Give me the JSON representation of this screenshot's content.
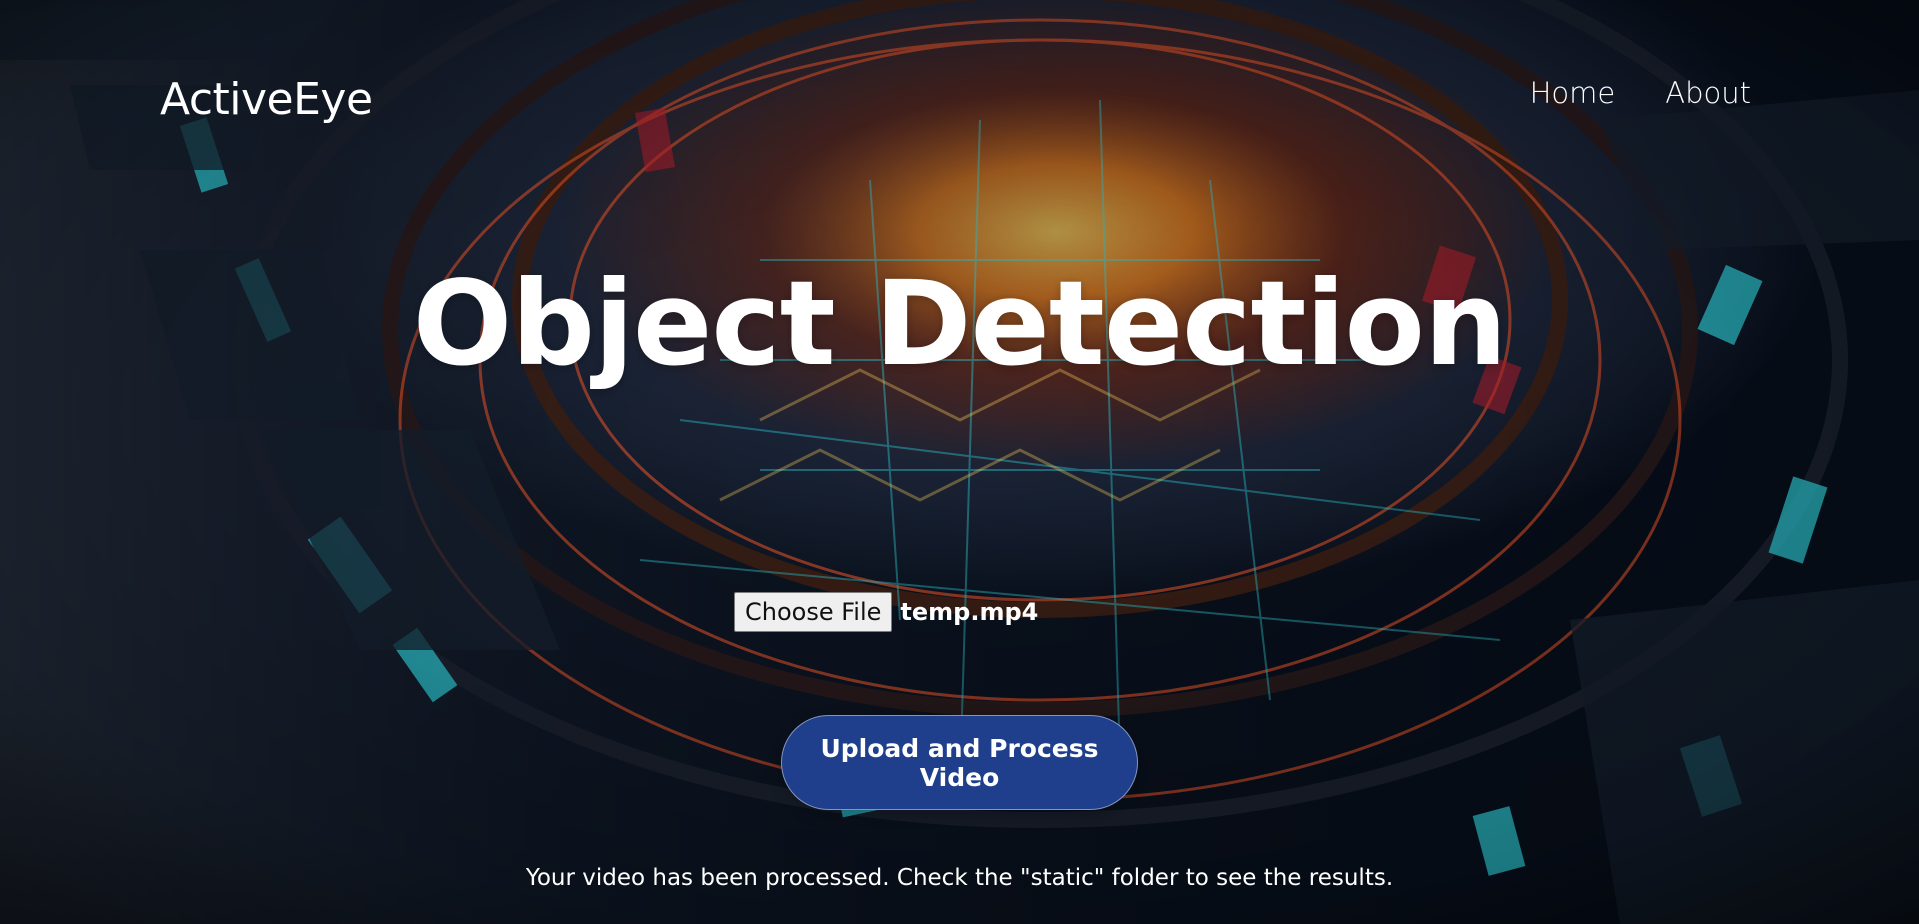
{
  "header": {
    "brand": "ActiveEye",
    "nav": [
      "Home",
      "About"
    ]
  },
  "hero": {
    "title": "Object Detection"
  },
  "upload": {
    "choose_file_label": "Choose File",
    "file_name": "temp.mp4",
    "button_label": "Upload and Process Video"
  },
  "status": {
    "message": "Your video has been processed. Check the \"static\" folder to see the results."
  },
  "colors": {
    "upload_button": "#1f3f8c",
    "background": "#0b1220",
    "accent_orange": "#ff7a1a",
    "accent_cyan": "#2ec5d0"
  }
}
